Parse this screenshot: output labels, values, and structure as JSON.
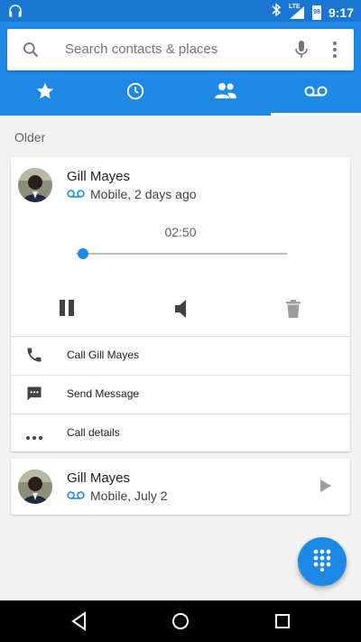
{
  "status_bar": {
    "time": "9:17",
    "network": "LTE",
    "battery_level": "98",
    "icons": [
      "headphones-icon",
      "bluetooth-icon",
      "signal-icon",
      "battery-icon"
    ]
  },
  "search": {
    "placeholder": "Search contacts & places"
  },
  "tabs": [
    {
      "icon": "star-icon",
      "name": "favorites",
      "active": false
    },
    {
      "icon": "clock-icon",
      "name": "recents",
      "active": false
    },
    {
      "icon": "people-icon",
      "name": "contacts",
      "active": false
    },
    {
      "icon": "voicemail-icon",
      "name": "voicemail",
      "active": true
    }
  ],
  "section": {
    "label": "Older"
  },
  "expanded_voicemail": {
    "name": "Gill Mayes",
    "subtitle": "Mobile, 2 days ago",
    "duration": "02:50",
    "progress": 0.03,
    "actions": [
      {
        "icon": "phone-icon",
        "label": "Call Gill Mayes"
      },
      {
        "icon": "message-icon",
        "label": "Send Message"
      },
      {
        "icon": "more-horiz-icon",
        "label": "Call details"
      }
    ]
  },
  "voicemail_item": {
    "name": "Gill Mayes",
    "subtitle": "Mobile, July 2"
  },
  "colors": {
    "primary": "#1e88e5",
    "status_bar": "#1976d2",
    "accent": "#1e88e5"
  }
}
